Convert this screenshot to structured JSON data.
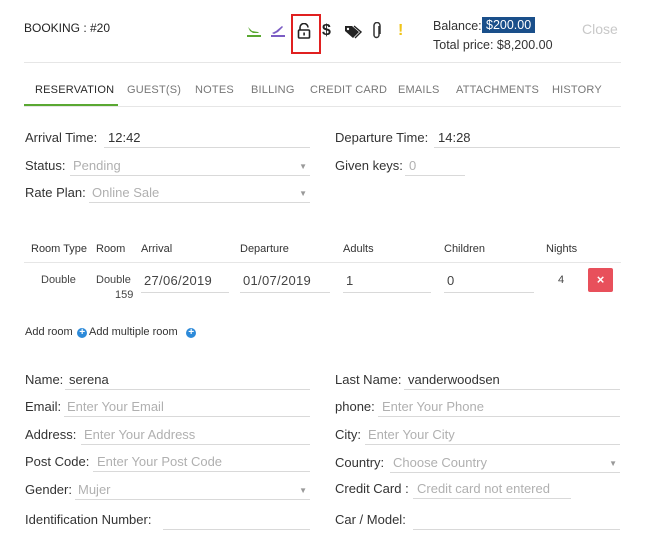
{
  "header": {
    "booking_label": "BOOKING : #20",
    "balance_label": "Balance:",
    "balance_value": "$200.00",
    "total_price": "Total price: $8,200.00",
    "close_label": "Close",
    "colors": {
      "accent_green": "#5aa832",
      "balance_badge": "#1a4f8a",
      "warning": "#f0c419",
      "highlight_box": "#e02020"
    },
    "icons": [
      "arrival-plane-icon",
      "departure-plane-icon",
      "lock-icon",
      "dollar-icon",
      "tags-icon",
      "paperclip-icon",
      "exclamation-icon"
    ]
  },
  "tabs": [
    {
      "label": "RESERVATION",
      "active": true
    },
    {
      "label": "GUEST(S)"
    },
    {
      "label": "NOTES"
    },
    {
      "label": "BILLING"
    },
    {
      "label": "CREDIT CARD"
    },
    {
      "label": "EMAILS"
    },
    {
      "label": "ATTACHMENTS"
    },
    {
      "label": "HISTORY"
    }
  ],
  "reservation": {
    "arrival_time_label": "Arrival Time:",
    "arrival_time_value": "12:42",
    "departure_time_label": "Departure Time:",
    "departure_time_value": "14:28",
    "status_label": "Status:",
    "status_value": "Pending",
    "given_keys_label": "Given keys:",
    "given_keys_value": "0",
    "rate_plan_label": "Rate Plan:",
    "rate_plan_value": "Online Sale"
  },
  "rooms_table": {
    "headers": [
      "Room Type",
      "Room",
      "Arrival",
      "Departure",
      "Adults",
      "Children",
      "Nights"
    ],
    "rows": [
      {
        "room_type": "Double",
        "room_line1": "Double",
        "room_line2": "159",
        "arrival": "27/06/2019",
        "departure": "01/07/2019",
        "adults": "1",
        "children": "0",
        "nights": "4",
        "delete_label": "×"
      }
    ],
    "add_room_label": "Add room",
    "add_multiple_label": "Add multiple room",
    "plus_symbol": "+"
  },
  "guest": {
    "name_label": "Name:",
    "name_value": "serena",
    "last_name_label": "Last Name:",
    "last_name_value": "vanderwoodsen",
    "email_label": "Email:",
    "email_placeholder": "Enter Your Email",
    "phone_label": "phone:",
    "phone_placeholder": "Enter Your Phone",
    "address_label": "Address:",
    "address_placeholder": "Enter Your Address",
    "city_label": "City:",
    "city_placeholder": "Enter Your City",
    "post_code_label": "Post Code:",
    "post_code_placeholder": "Enter Your Post Code",
    "country_label": "Country:",
    "country_value": "Choose Country",
    "gender_label": "Gender:",
    "gender_value": "Mujer",
    "credit_card_label": "Credit Card :",
    "credit_card_placeholder": "Credit card not entered",
    "identification_label": "Identification Number:",
    "car_model_label": "Car / Model:"
  }
}
